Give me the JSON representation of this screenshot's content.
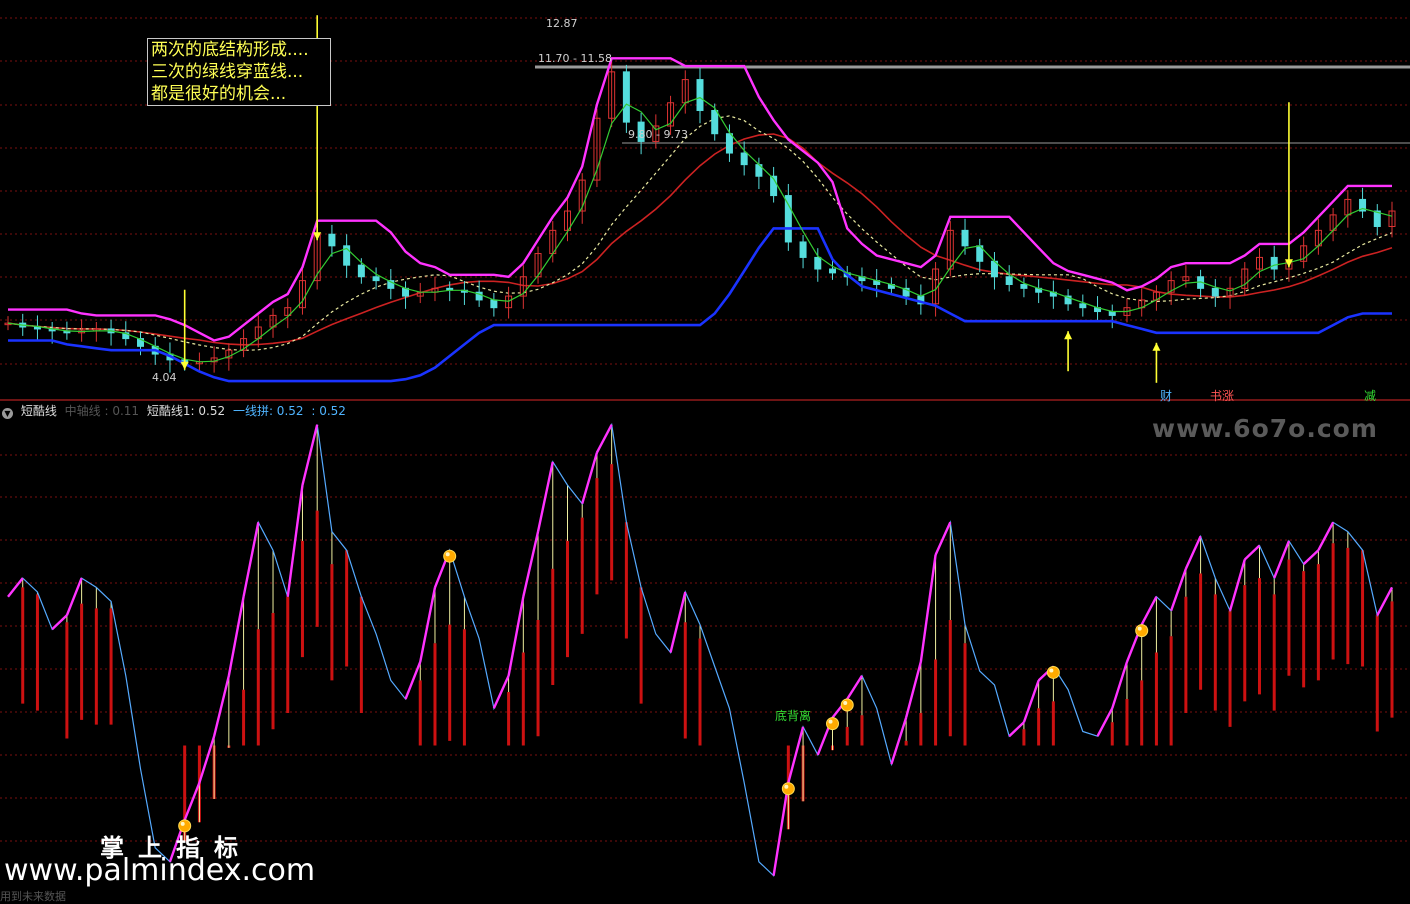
{
  "annotation": {
    "lines": [
      "两次的底结构形成....",
      "三次的绿线穿蓝线...",
      "都是很好的机会..."
    ]
  },
  "price_labels": {
    "high": "12.87",
    "level1": "11.70 - 11.58",
    "level2": "9.80 - 9.73",
    "low": "4.04"
  },
  "top_tags": [
    {
      "text": "财",
      "color": "#4fb4ff"
    },
    {
      "text": "书涨",
      "color": "#ff5555"
    },
    {
      "text": "减",
      "color": "#33dd33"
    }
  ],
  "indicator": {
    "name": "短酷线",
    "mid_line": "中轴线 : 0.11",
    "line1": "短酷线1: 0.52",
    "line2": "一线拼: 0.52",
    "line3": ": 0.52"
  },
  "divergence_label": "底背离",
  "watermarks": {
    "site1": "www.6o7o.com",
    "brand": "掌上指标",
    "site2": "www.palmindex.com",
    "footer": "用到未来数据"
  },
  "colors": {
    "background": "#000000",
    "grid": "#7a1010",
    "upper_band": "#ff33ff",
    "lower_band": "#1a33ff",
    "green_line": "#33cc33",
    "ma_red": "#cc2222",
    "ma_yellow": "#e8e8a0",
    "candle_up": "#dd3333",
    "candle_down": "#55dddd",
    "arrow": "#ffff33",
    "osc_line": "#55aaff",
    "osc_hot": "#ff33ff",
    "osc_hist": "#cc1111",
    "osc_hist_hi": "#f0f0a0"
  },
  "chart_data": [
    {
      "type": "line",
      "title": "",
      "note": "Candlestick price panel with upper/lower bands, green line and moving averages",
      "xlabel": "",
      "ylabel": "",
      "x_count": 95,
      "ylim": [
        3.5,
        13.2
      ],
      "series": [
        {
          "name": "close",
          "values": [
            5.1,
            5.0,
            4.95,
            4.9,
            4.85,
            4.9,
            4.95,
            4.85,
            4.7,
            4.5,
            4.3,
            4.15,
            4.05,
            4.1,
            4.2,
            4.4,
            4.7,
            5.0,
            5.3,
            5.5,
            6.2,
            7.4,
            7.1,
            6.6,
            6.3,
            6.2,
            6.0,
            5.8,
            5.9,
            6.0,
            5.95,
            5.9,
            5.7,
            5.5,
            5.8,
            6.3,
            6.9,
            7.5,
            8.0,
            8.8,
            10.4,
            11.6,
            10.3,
            9.8,
            10.2,
            10.8,
            11.4,
            10.6,
            10.0,
            9.5,
            9.2,
            8.9,
            8.4,
            7.2,
            6.8,
            6.5,
            6.4,
            6.3,
            6.2,
            6.1,
            6.0,
            5.8,
            5.6,
            6.5,
            7.5,
            7.1,
            6.7,
            6.3,
            6.1,
            6.0,
            5.9,
            5.8,
            5.6,
            5.5,
            5.4,
            5.3,
            5.5,
            5.7,
            5.9,
            6.2,
            6.3,
            6.0,
            5.8,
            6.0,
            6.5,
            6.8,
            6.5,
            6.7,
            7.1,
            7.5,
            7.9,
            8.3,
            8.0,
            7.6,
            8.0
          ]
        },
        {
          "name": "low",
          "values": [
            4.04
          ]
        },
        {
          "name": "high",
          "values": [
            12.87
          ]
        }
      ]
    },
    {
      "type": "area",
      "title": "",
      "note": "短酷线 oscillator",
      "xlabel": "",
      "ylabel": "",
      "ylim": [
        0,
        1
      ],
      "series": [
        {
          "name": "短酷线1",
          "values": [
            0.62,
            0.66,
            0.63,
            0.55,
            0.58,
            0.66,
            0.64,
            0.61,
            0.45,
            0.25,
            0.08,
            0.05,
            0.14,
            0.22,
            0.32,
            0.45,
            0.62,
            0.78,
            0.72,
            0.62,
            0.86,
            0.99,
            0.76,
            0.72,
            0.62,
            0.54,
            0.44,
            0.4,
            0.48,
            0.64,
            0.72,
            0.62,
            0.53,
            0.38,
            0.45,
            0.62,
            0.76,
            0.91,
            0.86,
            0.82,
            0.93,
            0.99,
            0.78,
            0.64,
            0.54,
            0.5,
            0.63,
            0.56,
            0.47,
            0.38,
            0.22,
            0.05,
            0.02,
            0.22,
            0.34,
            0.28,
            0.36,
            0.4,
            0.45,
            0.38,
            0.26,
            0.36,
            0.48,
            0.71,
            0.78,
            0.56,
            0.46,
            0.43,
            0.32,
            0.35,
            0.44,
            0.47,
            0.42,
            0.33,
            0.32,
            0.38,
            0.48,
            0.56,
            0.62,
            0.59,
            0.68,
            0.75,
            0.66,
            0.59,
            0.7,
            0.73,
            0.66,
            0.74,
            0.69,
            0.72,
            0.78,
            0.76,
            0.72,
            0.58,
            0.64
          ]
        }
      ]
    }
  ]
}
